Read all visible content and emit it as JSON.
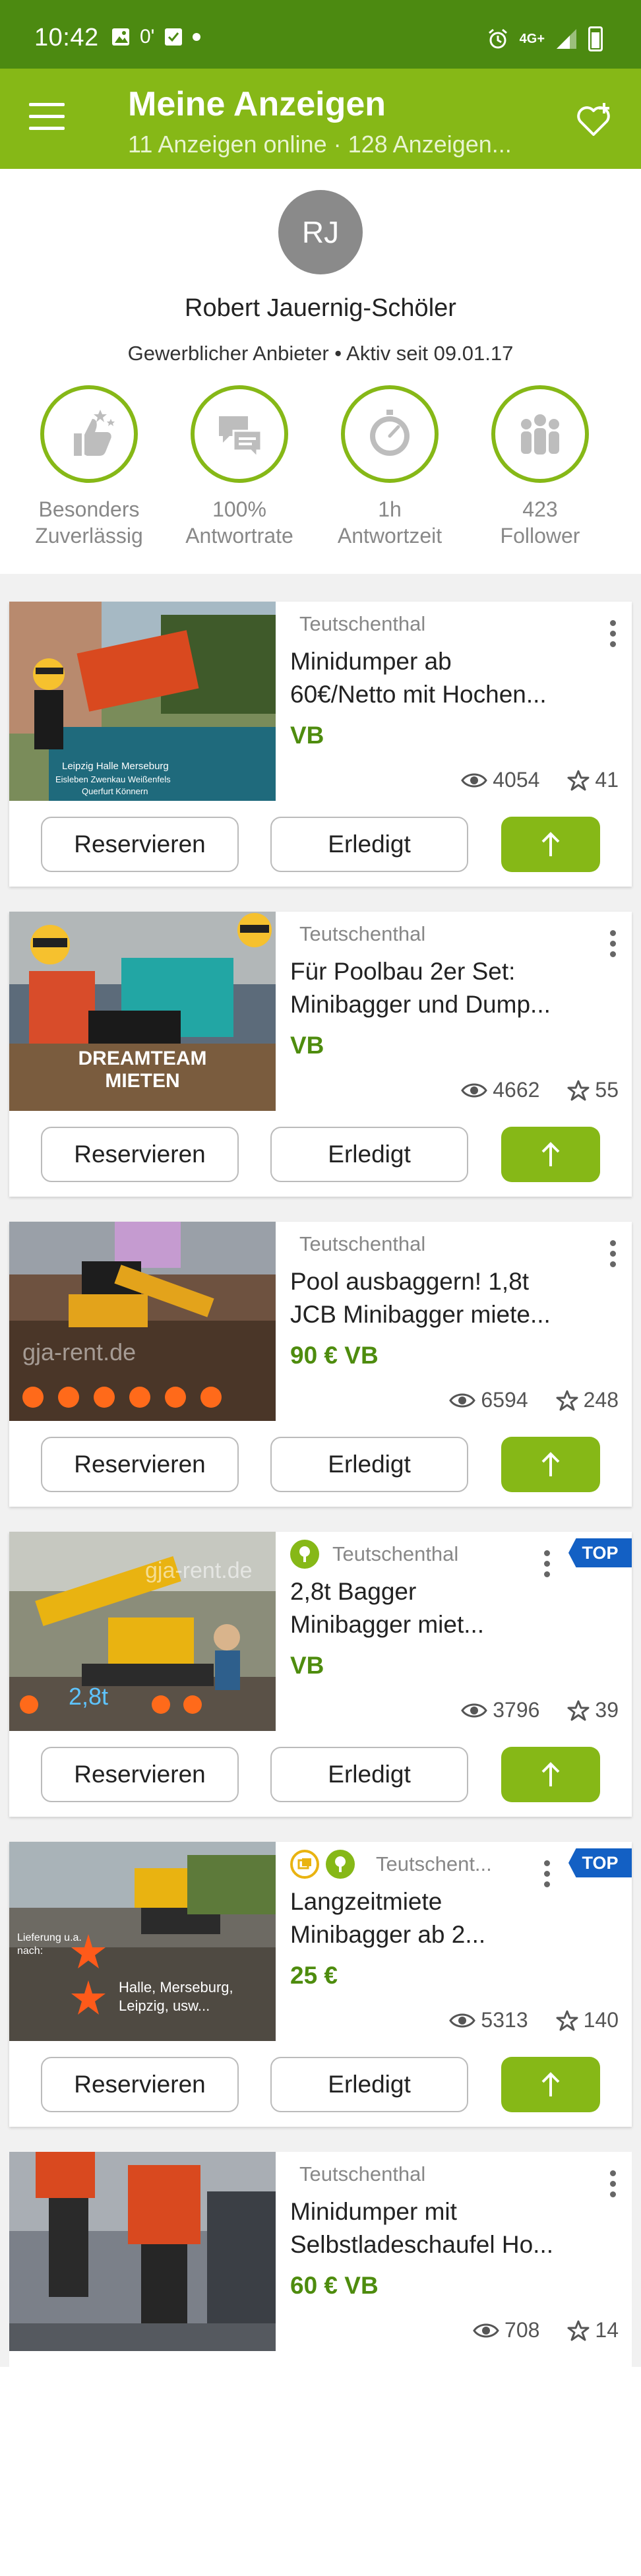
{
  "status_bar": {
    "time": "10:42",
    "network": "4G+",
    "icons": [
      "image-icon",
      "zero-icon",
      "check-box-icon",
      "dot-icon",
      "alarm-icon",
      "signal-icon",
      "battery-icon"
    ]
  },
  "app_bar": {
    "title": "Meine Anzeigen",
    "subtitle": "11 Anzeigen online · 128 Anzeigen...",
    "menu_icon": "hamburger-menu-icon",
    "action_icon": "heart-plus-icon"
  },
  "profile": {
    "initials": "RJ",
    "name": "Robert Jauernig-Schöler",
    "meta": "Gewerblicher Anbieter • Aktiv seit 09.01.17",
    "badges": [
      {
        "icon": "thumbs-up-stars-icon",
        "line1": "Besonders",
        "line2": "Zuverlässig"
      },
      {
        "icon": "chat-bubbles-icon",
        "line1": "100%",
        "line2": "Antwortrate"
      },
      {
        "icon": "stopwatch-icon",
        "line1": "1h",
        "line2": "Antwortzeit"
      },
      {
        "icon": "group-icon",
        "line1": "423",
        "line2": "Follower"
      }
    ]
  },
  "buttons": {
    "reserve": "Reservieren",
    "done": "Erledigt",
    "bump_icon": "arrow-up-icon"
  },
  "colors": {
    "brand_green": "#86b817",
    "status_green": "#4c8a11",
    "price_green": "#4e8c0e",
    "top_blue": "#1360c4"
  },
  "listings": [
    {
      "location": "Teutschenthal",
      "title_line1": "Minidumper ab",
      "title_line2": "60€/Netto mit Hochen...",
      "price": "VB",
      "views": "4054",
      "stars": "41",
      "top": "",
      "image_text": [
        "Leipzig  Halle  Merseburg",
        "Eisleben  Zwenkau  Weißenfels",
        "Querfurt  Könnern"
      ]
    },
    {
      "location": "Teutschenthal",
      "title_line1": "Für Poolbau 2er Set:",
      "title_line2": "Minibagger und Dump...",
      "price": "VB",
      "views": "4662",
      "stars": "55",
      "top": "",
      "image_text": [
        "DREAMTEAM",
        "MIETEN"
      ]
    },
    {
      "location": "Teutschenthal",
      "title_line1": "Pool ausbaggern! 1,8t",
      "title_line2": "JCB Minibagger miete...",
      "price": "90 € VB",
      "views": "6594",
      "stars": "248",
      "top": "",
      "image_text": [
        "gja-rent.de"
      ]
    },
    {
      "location": "Teutschenthal",
      "title_line1": "2,8t Bagger",
      "title_line2": "Minibagger miet...",
      "price": "VB",
      "views": "3796",
      "stars": "39",
      "top": "TOP",
      "image_text": [
        "gja-rent.de",
        "2,8t"
      ]
    },
    {
      "location": "Teutschent...",
      "title_line1": "Langzeitmiete",
      "title_line2": "Minibagger ab 2...",
      "price": "25 €",
      "views": "5313",
      "stars": "140",
      "top": "TOP",
      "image_text": [
        "Lieferung u.a.",
        "nach:",
        "Halle, Merseburg,",
        "Leipzig, usw..."
      ]
    },
    {
      "location": "Teutschenthal",
      "title_line1": "Minidumper mit",
      "title_line2": "Selbstladeschaufel Ho...",
      "price": "60 € VB",
      "views": "708",
      "stars": "14",
      "top": "",
      "image_text": []
    }
  ]
}
